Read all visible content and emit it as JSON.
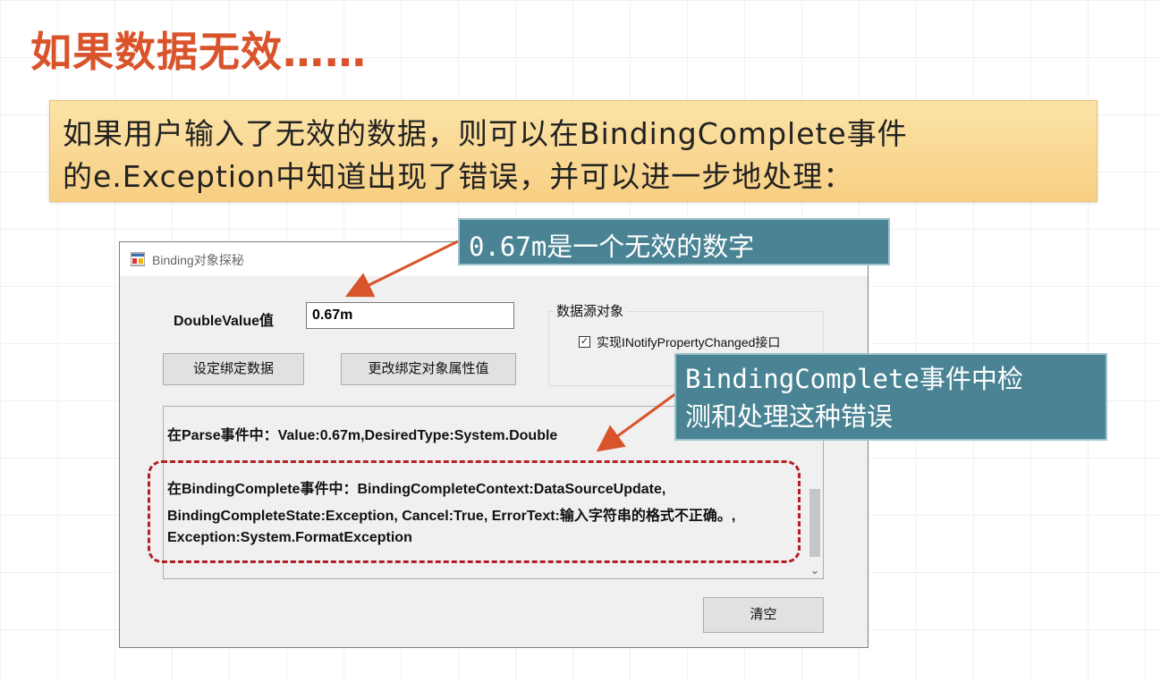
{
  "slide": {
    "title": "如果数据无效……",
    "description": {
      "line1": "如果用户输入了无效的数据，则可以在BindingComplete事件",
      "line2": "的e.Exception中知道出现了错误，并可以进一步地处理："
    }
  },
  "callouts": {
    "invalid_number": "0.67m是一个无效的数字",
    "binding_complete": {
      "line1": "BindingComplete事件中检",
      "line2": "测和处理这种错误"
    }
  },
  "window": {
    "title": "Binding对象探秘",
    "double_value_label": "DoubleValue值",
    "double_value_input": "0.67m",
    "set_binding_button": "设定绑定数据",
    "change_binding_button": "更改绑定对象属性值",
    "datasource_group": {
      "title": "数据源对象",
      "checkbox_checked": true,
      "checkbox_label": "实现INotifyPropertyChanged接口"
    },
    "log": {
      "line1": "在Parse事件中：Value:0.67m,DesiredType:System.Double",
      "line2": "在BindingComplete事件中：BindingCompleteContext:DataSourceUpdate,",
      "line3": "BindingCompleteState:Exception, Cancel:True, ErrorText:输入字符串的格式不正确。,",
      "line4": "Exception:System.FormatException"
    },
    "clear_button": "清空"
  },
  "colors": {
    "title": "#d9532b",
    "callout_bg": "#4a8494",
    "arrow": "#d9532b",
    "highlight_dash": "#b41f24",
    "description_bg": "#f8cf83"
  }
}
